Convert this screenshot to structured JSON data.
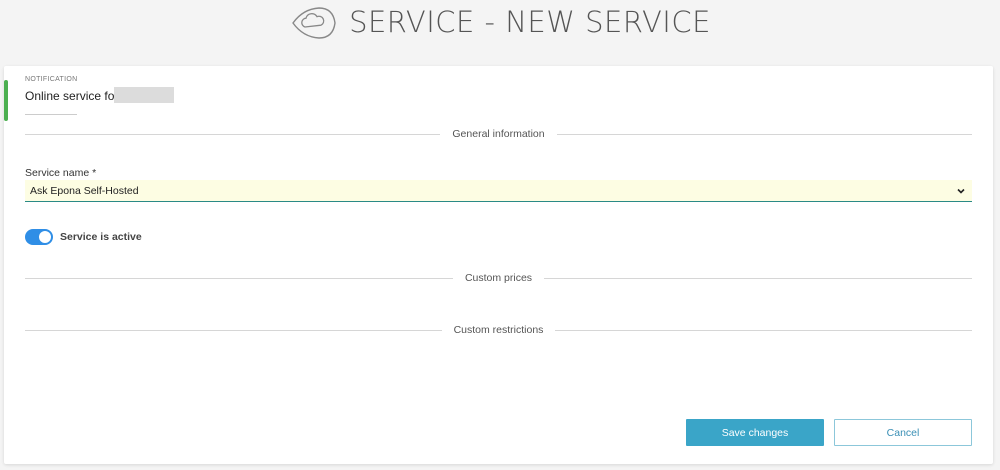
{
  "header": {
    "title": "SERVICE - NEW SERVICE",
    "logo_icon": "cloud-leaf-icon"
  },
  "notification": {
    "label": "NOTIFICATION",
    "text": "Online service for",
    "accent_color": "#4caf50"
  },
  "sections": {
    "general": "General information",
    "prices": "Custom prices",
    "restrictions": "Custom restrictions"
  },
  "service_name": {
    "label": "Service name *",
    "value": "Ask Epona Self-Hosted"
  },
  "active_toggle": {
    "label": "Service is active",
    "on": true
  },
  "buttons": {
    "save": "Save changes",
    "cancel": "Cancel"
  },
  "colors": {
    "primary": "#3aa5c8",
    "toggle": "#2f8ee6",
    "field_bg": "#fdfde3"
  }
}
